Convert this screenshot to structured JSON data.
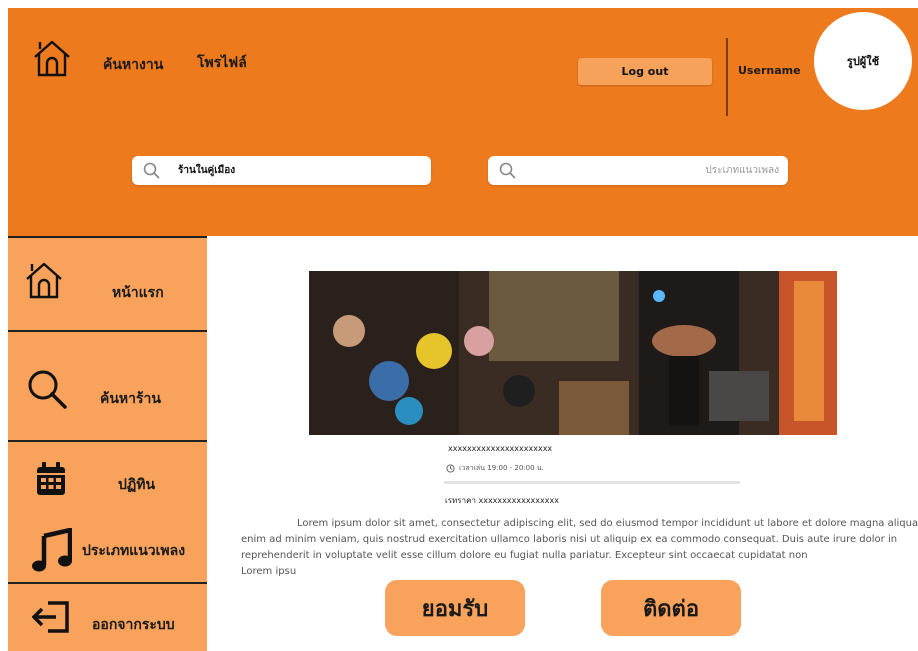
{
  "header": {
    "nav": [
      "ค้นหางาน",
      "โพรไฟล์"
    ],
    "logout_label": "Log out",
    "username": "Username",
    "avatar_label": "รูปผู้ใช้",
    "search_shop_value": "ร้านในคู่เมือง",
    "search_genre_placeholder": "ประเภทแนวเพลง"
  },
  "sidebar": {
    "items": [
      {
        "label": "หน้าแรก",
        "icon": "home-icon"
      },
      {
        "label": "ค้นหาร้าน",
        "icon": "search-icon"
      },
      {
        "label": "ปฏิทิน",
        "icon": "calendar-icon"
      },
      {
        "label": "ประเภทแนวเพลง",
        "icon": "music-note-icon"
      },
      {
        "label": "ออกจากระบบ",
        "icon": "logout-icon"
      }
    ]
  },
  "event": {
    "title": "xxxxxxxxxxxxxxxxxxxxxx",
    "time": "เวลาเล่น 19:00 - 20:00 น.",
    "price": "เรทราคา xxxxxxxxxxxxxxxxx",
    "description": [
      "Lorem ipsum dolor sit amet, consectetur adipiscing elit, sed do eiusmod tempor incididunt ut labore et dolore magna aliqua. Ut",
      "enim ad minim veniam, quis nostrud exercitation ullamco laboris nisi ut aliquip ex ea commodo consequat. Duis aute irure dolor in",
      "reprehenderit in voluptate velit esse cillum dolore eu fugiat nulla pariatur. Excepteur sint occaecat cupidatat non",
      "Lorem ipsu"
    ]
  },
  "actions": {
    "accept_label": "ยอมรับ",
    "contact_label": "ติดต่อ"
  },
  "colors": {
    "header_orange": "#ee7a1e",
    "sidebar_orange": "#f8a25c",
    "logout_button": "#f7a25a"
  }
}
